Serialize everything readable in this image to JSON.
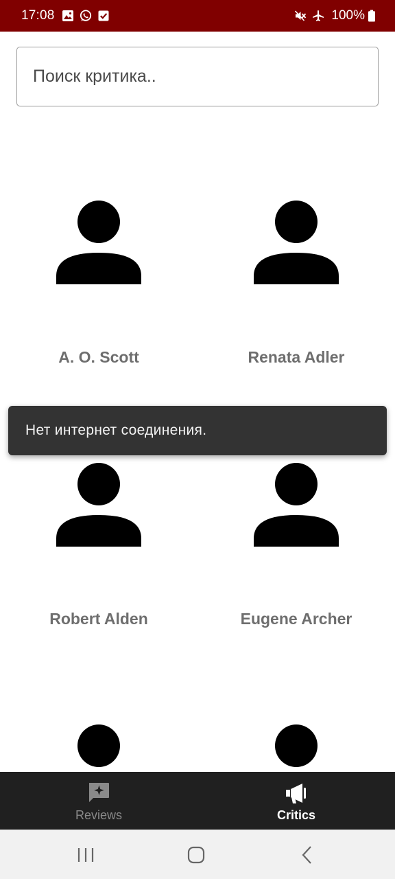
{
  "status_bar": {
    "time": "17:08",
    "battery": "100%",
    "left_icons": [
      "gallery-icon",
      "whatsapp-icon",
      "checkbox-icon"
    ],
    "right_icons": [
      "mute-icon",
      "airplane-icon",
      "battery-icon"
    ]
  },
  "search": {
    "placeholder": "Поиск критика.."
  },
  "critics": [
    {
      "name": "A. O. Scott",
      "avatar": "person-icon"
    },
    {
      "name": "Renata Adler",
      "avatar": "person-icon"
    },
    {
      "name": "Robert Alden",
      "avatar": "person-icon"
    },
    {
      "name": "Eugene Archer",
      "avatar": "person-icon"
    },
    {
      "name": "",
      "avatar": "person-icon"
    },
    {
      "name": "",
      "avatar": "person-icon"
    }
  ],
  "snackbar": {
    "message": "Нет интернет соединения."
  },
  "bottom_nav": {
    "items": [
      {
        "label": "Reviews",
        "icon": "review-sparkle-icon",
        "active": false
      },
      {
        "label": "Critics",
        "icon": "megaphone-icon",
        "active": true
      }
    ]
  },
  "colors": {
    "status_bar": "#800000",
    "bottom_nav": "#202020",
    "snackbar": "#333333",
    "critic_name": "#6e6e6e"
  }
}
